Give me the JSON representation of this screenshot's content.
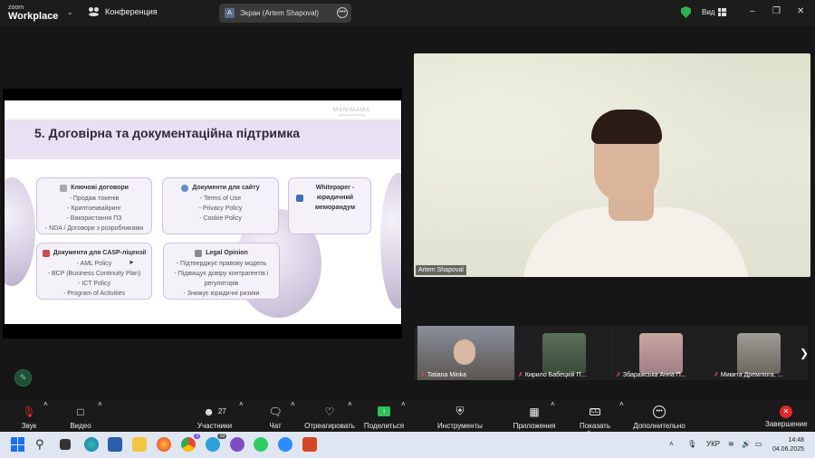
{
  "app": {
    "logo_top": "zoom",
    "logo_bottom": "Workplace",
    "meeting_label": "Конференция",
    "screen_share_label": "Экран (Artem Shapoval)",
    "screen_share_avatar": "A",
    "view_label": "Вид"
  },
  "slide": {
    "brand": "MANIMAMA",
    "brand_sub": "LEGAL ASSISTANCE",
    "title": "5. Договірна та документаційна підтримка",
    "cards": [
      {
        "title": "Ключові договори",
        "items": [
          "- Продаж токенів",
          "- Криптоеквайринг",
          "- Використання ПЗ",
          "- NDA / Договори з розробниками"
        ]
      },
      {
        "title": "Документи для сайту",
        "items": [
          "- Terms of Use",
          "- Privacy Policy",
          "- Cookie Policy"
        ]
      },
      {
        "title": "Whitepaper - юридичний меморандум",
        "items": []
      },
      {
        "title": "Документи для CASP-ліцензії",
        "items": [
          "- AML Policy",
          "- BCP (Business Continuity Plan)",
          "- ICT Policy",
          "- Program of Activities"
        ]
      },
      {
        "title": "Legal Opinion",
        "items": [
          "- Підтверджує правову модель",
          "- Підвищує довіру контрагентів і регуляторів",
          "- Знижує юридичні ризики"
        ]
      }
    ]
  },
  "main_video": {
    "name": "Artem Shapoval"
  },
  "thumbnails": [
    {
      "name": "Tatiana Minka"
    },
    {
      "name": "Кирило Бабецкій П..."
    },
    {
      "name": "Збаражська Анна П..."
    },
    {
      "name": "Микита Дремлюга, ..."
    }
  ],
  "toolbar": {
    "mic": "Звук",
    "video": "Видео",
    "participants": "Участники",
    "participants_count": "27",
    "chat": "Чат",
    "react": "Отреагировать",
    "share": "Поделиться",
    "host_tools": "Инструменты организатора",
    "apps": "Приложения",
    "captions": "Показать субтитры",
    "more": "Дополнительно",
    "end": "Завершение"
  },
  "taskbar": {
    "lang": "УКР",
    "time": "14:48",
    "date": "04.06.2025",
    "chrome_badge": "3",
    "telegram_badge": "19"
  },
  "colors": {
    "accent_green": "#2fae4f",
    "share_green": "#2dbf59",
    "end_red": "#e02828",
    "slide_band": "#e8e0f3"
  }
}
